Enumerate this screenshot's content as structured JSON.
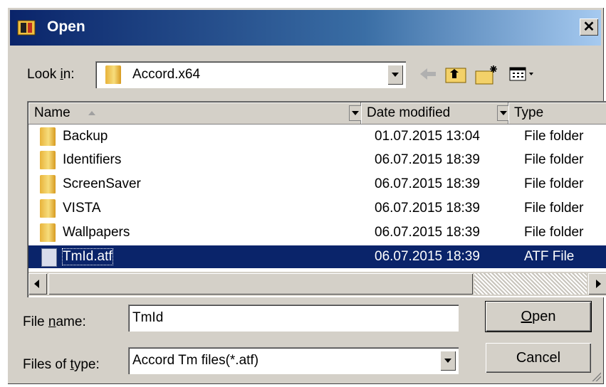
{
  "window": {
    "title": "Open"
  },
  "lookin": {
    "label_pre": "Look ",
    "label_u": "i",
    "label_post": "n:",
    "value": "Accord.x64"
  },
  "columns": {
    "name": "Name",
    "date": "Date modified",
    "type": "Type"
  },
  "files": [
    {
      "name": "Backup",
      "date": "01.07.2015 13:04",
      "type": "File folder",
      "kind": "folder"
    },
    {
      "name": "Identifiers",
      "date": "06.07.2015 18:39",
      "type": "File folder",
      "kind": "folder"
    },
    {
      "name": "ScreenSaver",
      "date": "06.07.2015 18:39",
      "type": "File folder",
      "kind": "folder"
    },
    {
      "name": "VISTA",
      "date": "06.07.2015 18:39",
      "type": "File folder",
      "kind": "folder"
    },
    {
      "name": "Wallpapers",
      "date": "06.07.2015 18:39",
      "type": "File folder",
      "kind": "folder"
    },
    {
      "name": "TmId.atf",
      "date": "06.07.2015 18:39",
      "type": "ATF File",
      "kind": "file",
      "selected": true
    }
  ],
  "filename": {
    "label_pre": "File ",
    "label_u": "n",
    "label_post": "ame:",
    "value": "TmId"
  },
  "filetype": {
    "label_pre": "Files of ",
    "label_u": "t",
    "label_post": "ype:",
    "value": "Accord Tm files(*.atf)"
  },
  "buttons": {
    "open_u": "O",
    "open_rest": "pen",
    "cancel": "Cancel"
  },
  "icons": {
    "back": "back-arrow-icon",
    "up": "up-folder-icon",
    "newfolder": "new-folder-icon",
    "views": "views-menu-icon"
  }
}
